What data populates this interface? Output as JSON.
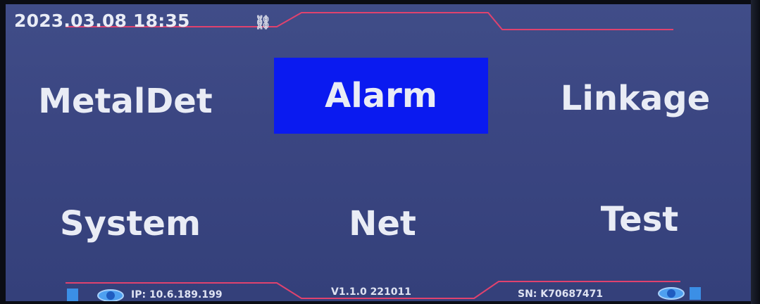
{
  "header": {
    "datetime": "2023.03.08 18:35",
    "link_icon_glyph": "⛓",
    "link_icon_name": "link-icon"
  },
  "menu": {
    "items": [
      {
        "id": "metaldet",
        "label": "MetalDet",
        "selected": false
      },
      {
        "id": "alarm",
        "label": "Alarm",
        "selected": true
      },
      {
        "id": "linkage",
        "label": "Linkage",
        "selected": false
      },
      {
        "id": "system",
        "label": "System",
        "selected": false
      },
      {
        "id": "net",
        "label": "Net",
        "selected": false
      },
      {
        "id": "test",
        "label": "Test",
        "selected": false
      }
    ]
  },
  "footer": {
    "ip": "IP: 10.6.189.199",
    "version": "V1.1.0 221011",
    "sn": "SN: K70687471"
  },
  "colors": {
    "background": "#3b4682",
    "selected": "#0a1af0",
    "accent_line": "#e0426e",
    "status_icon": "#3b8fe6"
  }
}
